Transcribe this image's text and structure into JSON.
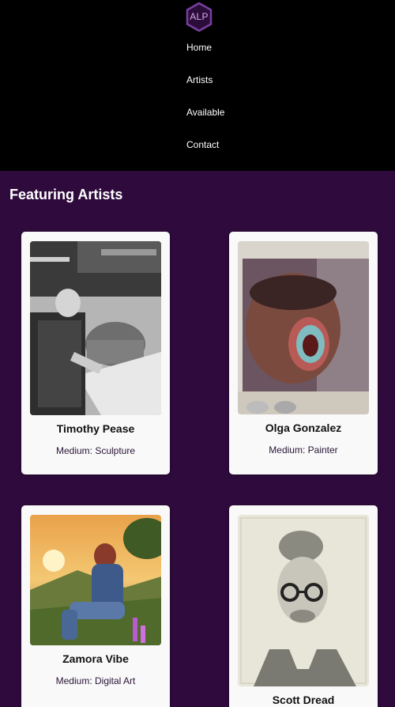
{
  "header": {
    "logo_text": "ALP",
    "nav": [
      {
        "label": "Home"
      },
      {
        "label": "Artists"
      },
      {
        "label": "Available"
      },
      {
        "label": "Contact"
      }
    ]
  },
  "main": {
    "heading": "Featuring Artists",
    "medium_prefix": "Medium:",
    "artists": [
      {
        "name": "Timothy Pease",
        "medium": "Sculpture"
      },
      {
        "name": "Olga Gonzalez",
        "medium": "Painter"
      },
      {
        "name": "Zamora Vibe",
        "medium": "Digital Art"
      },
      {
        "name": "Scott Dread",
        "medium": ""
      }
    ]
  },
  "colors": {
    "header_bg": "#000000",
    "page_bg": "#2e0b3c",
    "card_bg": "#f9f9f9",
    "logo_accent": "#7b3fa0"
  }
}
